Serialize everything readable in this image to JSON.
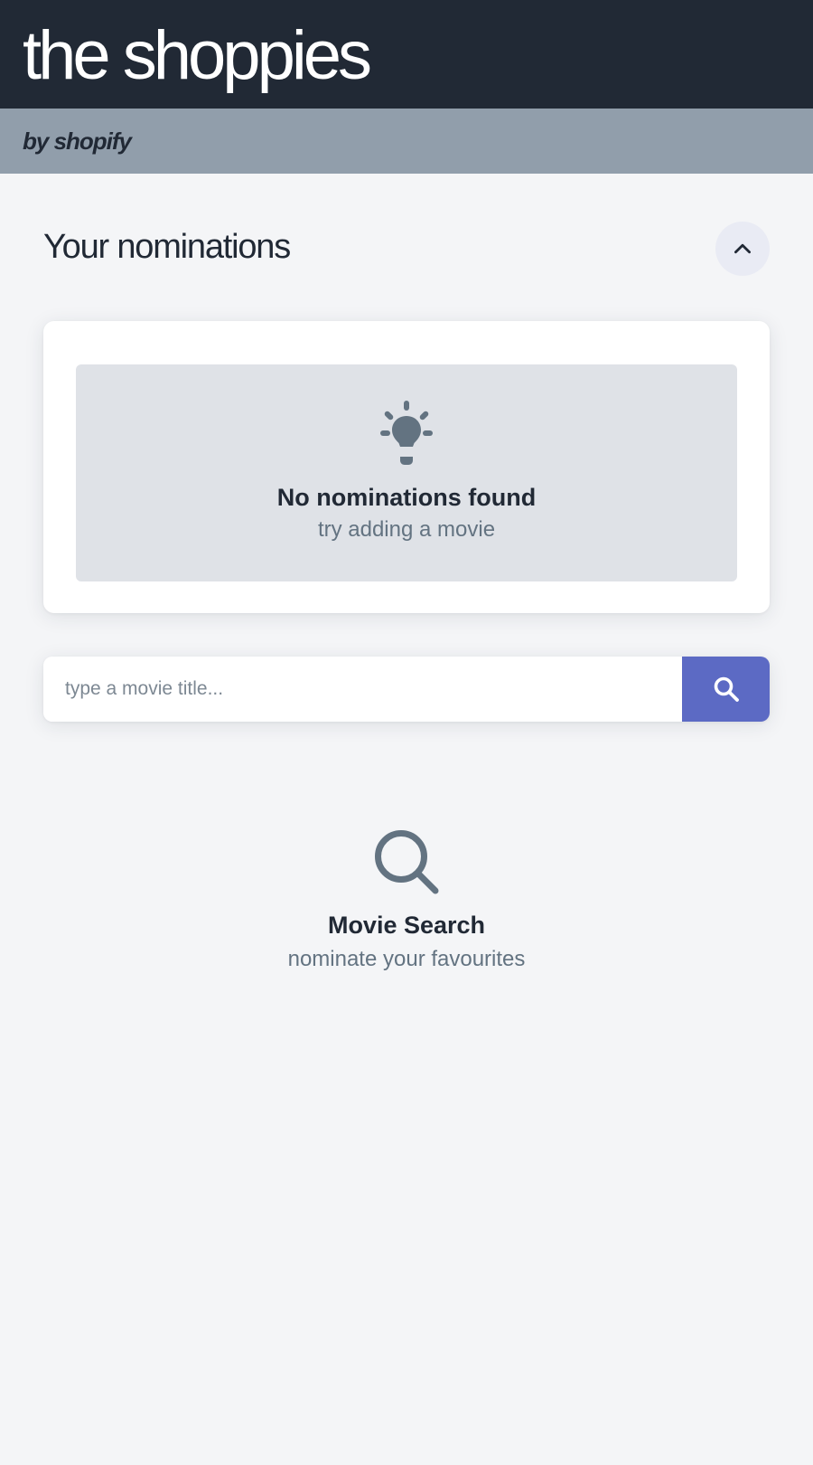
{
  "header": {
    "title": "the shoppies",
    "subtitle": "by shopify"
  },
  "colors": {
    "header_bg": "#212935",
    "subheader_bg": "#919eab",
    "page_bg": "#f4f5f7",
    "accent": "#5c6ac4",
    "text_dark": "#212935",
    "text_muted": "#637381"
  },
  "nominations": {
    "title": "Your nominations",
    "toggle_icon": "chevron-up-icon",
    "empty_icon": "lightbulb-icon",
    "empty_title": "No nominations found",
    "empty_subtitle": "try adding a movie"
  },
  "search": {
    "placeholder": "type a movie title...",
    "value": "",
    "button_icon": "search-icon"
  },
  "search_placeholder": {
    "icon": "magnifier-icon",
    "title": "Movie Search",
    "subtitle": "nominate your favourites"
  }
}
